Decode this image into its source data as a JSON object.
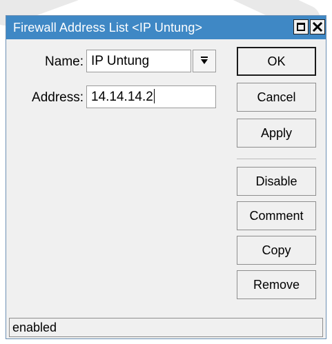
{
  "window": {
    "title": "Firewall Address List <IP Untung>",
    "maximize_icon": "maximize-icon",
    "close_icon": "close-icon"
  },
  "form": {
    "name_label": "Name:",
    "name_value": "IP Untung",
    "name_dropdown_icon": "arrow-down-icon",
    "address_label": "Address:",
    "address_value": "14.14.14.2"
  },
  "buttons": {
    "ok": "OK",
    "cancel": "Cancel",
    "apply": "Apply",
    "disable": "Disable",
    "comment": "Comment",
    "copy": "Copy",
    "remove": "Remove"
  },
  "status": {
    "text": "enabled"
  },
  "colors": {
    "titlebar": "#3f88c5",
    "window_bg": "#f0f0f0"
  }
}
